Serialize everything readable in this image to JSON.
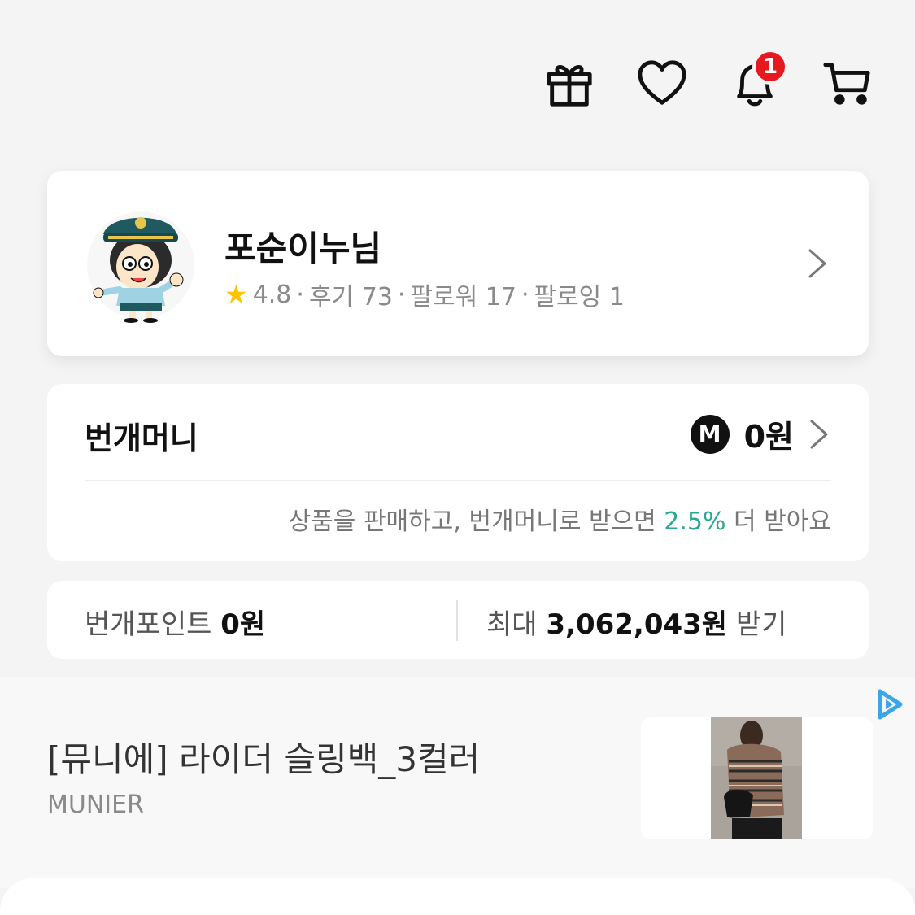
{
  "header": {
    "icons": [
      "gift-icon",
      "heart-icon",
      "bell-icon",
      "cart-icon"
    ],
    "notification_count": "1"
  },
  "profile": {
    "name": "포순이누님",
    "rating": "4.8",
    "reviews": "후기 73",
    "followers": "팔로워 17",
    "following": "팔로잉 1",
    "separator": "·"
  },
  "money": {
    "title": "번개머니",
    "badge_letter": "M",
    "amount": "0원",
    "promo_prefix": "상품을 판매하고, 번개머니로 받으면 ",
    "promo_rate": "2.5%",
    "promo_suffix": " 더 받아요"
  },
  "points": {
    "label": "번개포인트",
    "amount": "0원",
    "max_prefix": "최대",
    "max_amount": "3,062,043원",
    "max_suffix": "받기"
  },
  "ad": {
    "title": "[뮤니에] 라이더 슬링백_3컬러",
    "brand": "MUNIER"
  },
  "colors": {
    "accent_green": "#2aa890",
    "badge_red": "#e5191e",
    "star_yellow": "#ffc400",
    "ad_blue": "#3aa6e8"
  }
}
